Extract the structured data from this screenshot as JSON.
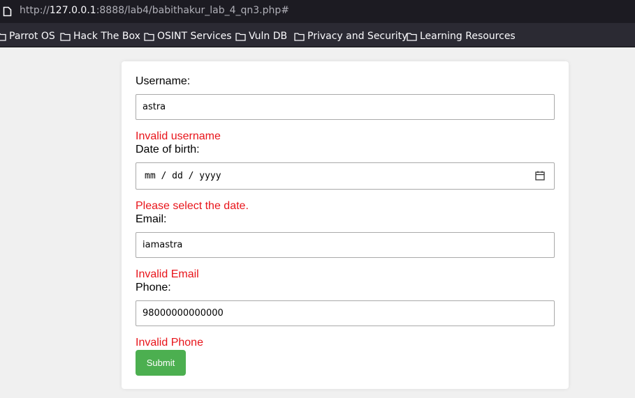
{
  "browser": {
    "url_prefix": "http://",
    "url_host": "127.0.0.1",
    "url_rest": ":8888/lab4/babithakur_lab_4_qn3.php#"
  },
  "bookmarks": [
    {
      "label": "Parrot OS"
    },
    {
      "label": "Hack The Box"
    },
    {
      "label": "OSINT Services"
    },
    {
      "label": "Vuln DB"
    },
    {
      "label": "Privacy and Security"
    },
    {
      "label": "Learning Resources"
    }
  ],
  "form": {
    "username_label": "Username:",
    "username_value": "astra",
    "username_error": "Invalid username",
    "dob_label": "Date of birth:",
    "dob_value": "mm / dd / yyyy",
    "dob_error": "Please select the date.",
    "email_label": "Email:",
    "email_value": "iamastra",
    "email_error": "Invalid Email",
    "phone_label": "Phone:",
    "phone_value": "98000000000000",
    "phone_error": "Invalid Phone",
    "submit_label": "Submit"
  },
  "colors": {
    "error": "#e8141a",
    "submit_bg": "#4caf50"
  }
}
